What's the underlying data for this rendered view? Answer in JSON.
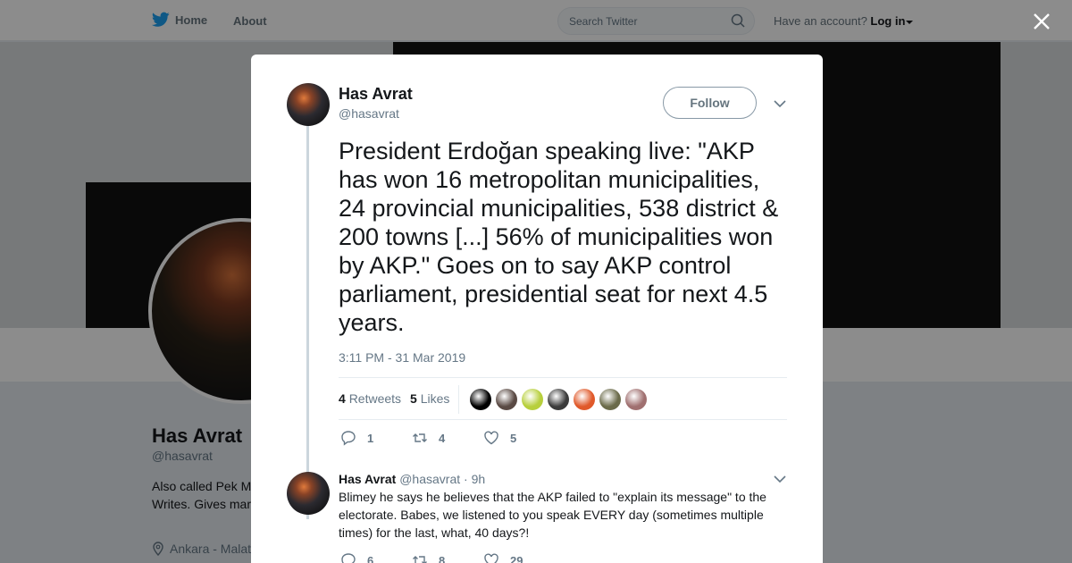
{
  "topbar": {
    "home_label": "Home",
    "about_label": "About",
    "search_placeholder": "Search Twitter",
    "account_prefix": "Have an account?",
    "login_label": "Log in"
  },
  "profile": {
    "name": "Has Avrat",
    "handle": "@hasavrat",
    "bio": "Also called Pek M... on occasion. Phot... Writes. Gives mar...",
    "location": "Ankara - Malat..."
  },
  "tweet": {
    "author_name": "Has Avrat",
    "author_handle": "@hasavrat",
    "follow_label": "Follow",
    "text": "President Erdoğan speaking live: \"AKP has won 16 metropolitan municipalities, 24 provincial municipalities, 538 district & 200 towns [...] 56% of municipalities won by AKP.\" Goes on to say AKP control parliament, presidential seat for next 4.5 years.",
    "timestamp": "3:11 PM - 31 Mar 2019",
    "retweets_count": "4",
    "retweets_label": "Retweets",
    "likes_count": "5",
    "likes_label": "Likes",
    "reply_count": "1",
    "retweet_count": "4",
    "like_count": "5",
    "liker_colors": [
      "#000000",
      "#5a4a44",
      "#b7cf3c",
      "#3b3b3b",
      "#e0592a",
      "#6b6b4a",
      "#a07070"
    ]
  },
  "reply": {
    "author_name": "Has Avrat",
    "author_handle": "@hasavrat",
    "time": "· 9h",
    "text": "Blimey he says he believes that the AKP failed to \"explain its message\" to the electorate. Babes, we listened to you speak EVERY day (sometimes multiple times) for the last, what, 40 days?!",
    "reply_count": "6",
    "retweet_count": "8",
    "like_count": "29"
  },
  "colors": {
    "brand": "#1da1f2",
    "text_secondary": "#657786"
  }
}
